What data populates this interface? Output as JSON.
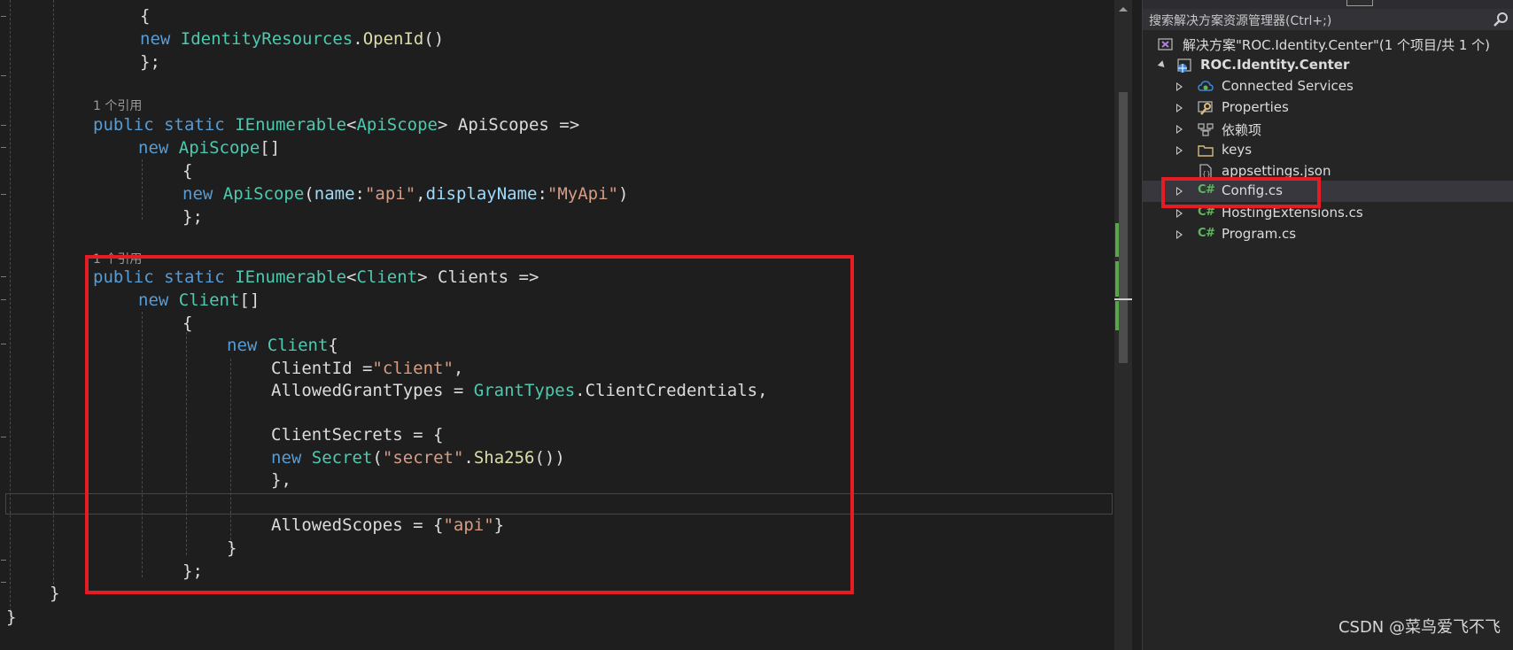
{
  "editor": {
    "code_lens": [
      "1 个引用",
      "1 个引用"
    ],
    "lines": {
      "l2": "{",
      "l3_new": "new",
      "l3_type": "IdentityResources",
      "l3_dot": ".",
      "l3_method": "OpenId",
      "l3_end": "()",
      "l4": "};",
      "l6_public": "public",
      "l6_static": "static",
      "l6_ienum": "IEnumerable",
      "l6_lt": "<",
      "l6_type": "ApiScope",
      "l6_rest": "> ApiScopes =>",
      "l7_new": "new",
      "l7_type": "ApiScope",
      "l7_end": "[]",
      "l8": "{",
      "l9_new": "new",
      "l9_type": "ApiScope",
      "l9_paren": "(",
      "l9_p1": "name",
      "l9_c1": ":",
      "l9_s1": "\"api\"",
      "l9_comma": ",",
      "l9_p2": "displayName",
      "l9_c2": ":",
      "l9_s2": "\"MyApi\"",
      "l9_end": ")",
      "l10": "};",
      "l12_public": "public",
      "l12_static": "static",
      "l12_ienum": "IEnumerable",
      "l12_lt": "<",
      "l12_type": "Client",
      "l12_rest": "> Clients =>",
      "l13_new": "new",
      "l13_type": "Client",
      "l13_end": "[]",
      "l14": "{",
      "l15_new": "new",
      "l15_type": "Client",
      "l15_brace": "{",
      "l16_a": "ClientId =",
      "l16_s": "\"client\"",
      "l16_e": ",",
      "l17_a": "AllowedGrantTypes = ",
      "l17_type": "GrantTypes",
      "l17_rest": ".ClientCredentials,",
      "l19": "ClientSecrets = {",
      "l20_new": "new",
      "l20_type": "Secret",
      "l20_paren": "(",
      "l20_s": "\"secret\"",
      "l20_dot": ".",
      "l20_method": "Sha256",
      "l20_end": "())",
      "l21": "},",
      "l23_a": "AllowedScopes = {",
      "l23_s": "\"api\"",
      "l23_e": "}",
      "l24": "}",
      "l25": "};",
      "l26": "}",
      "l27": "}"
    }
  },
  "solution_explorer": {
    "search_placeholder": "搜索解决方案资源管理器(Ctrl+;)",
    "solution_label": "解决方案\"ROC.Identity.Center\"(1 个项目/共 1 个)",
    "project_label": "ROC.Identity.Center",
    "items": [
      {
        "label": "Connected Services",
        "icon": "connected-services-icon"
      },
      {
        "label": "Properties",
        "icon": "wrench-icon"
      },
      {
        "label": "依赖项",
        "icon": "dependencies-icon"
      },
      {
        "label": "keys",
        "icon": "folder-icon"
      },
      {
        "label": "appsettings.json",
        "icon": "json-file-icon"
      },
      {
        "label": "Config.cs",
        "icon": "csharp-file-icon"
      },
      {
        "label": "HostingExtensions.cs",
        "icon": "csharp-file-icon"
      },
      {
        "label": "Program.cs",
        "icon": "csharp-file-icon"
      }
    ],
    "csharp_glyph": "C#"
  },
  "watermark": "CSDN @菜鸟爱飞不飞",
  "colors": {
    "keyword": "#569cd6",
    "type": "#4ec9b0",
    "string": "#d69d85",
    "parameter": "#9cdcfe",
    "method": "#dcdcaa",
    "highlight": "#e51c23"
  }
}
